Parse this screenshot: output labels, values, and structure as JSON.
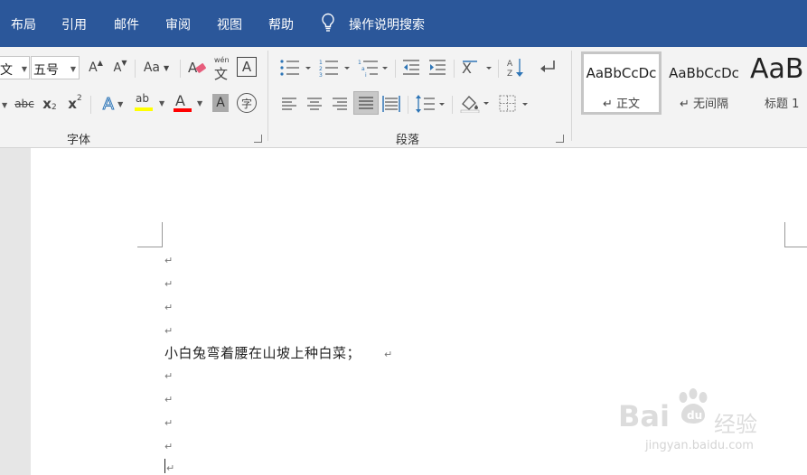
{
  "menubar": {
    "items": [
      "布局",
      "引用",
      "邮件",
      "审阅",
      "视图",
      "帮助"
    ],
    "search_label": "操作说明搜索"
  },
  "font_group": {
    "font_name_partial": "文",
    "font_size": "五号",
    "grow_label": "A",
    "shrink_label": "A",
    "change_case_label": "Aa",
    "phonetic_label": "wén",
    "char_border_label": "A",
    "strike_label": "abc",
    "subscript_label": "x",
    "subscript_sub": "2",
    "superscript_label": "x",
    "superscript_sup": "2",
    "text_effect_label": "A",
    "highlight_label": "ab",
    "font_color_label": "A",
    "char_shading_label": "A",
    "enclose_label": "字",
    "group_label": "字体",
    "colors": {
      "highlight": "#ffff00",
      "font_color": "#ff0000"
    }
  },
  "paragraph_group": {
    "group_label": "段落"
  },
  "styles": {
    "items": [
      {
        "sample": "AaBbCcDc",
        "name": "正文"
      },
      {
        "sample": "AaBbCcDc",
        "name": "无间隔"
      },
      {
        "sample": "AaB",
        "name": "标题 1"
      }
    ]
  },
  "document": {
    "paragraph_mark": "↵",
    "line_text": "小白兔弯着腰在山坡上种白菜；"
  },
  "watermark": {
    "brand": "Bai",
    "brand_suffix": "经验",
    "url": "jingyan.baidu.com"
  },
  "colors": {
    "menubar": "#2b579a",
    "ribbon": "#f3f3f3"
  }
}
